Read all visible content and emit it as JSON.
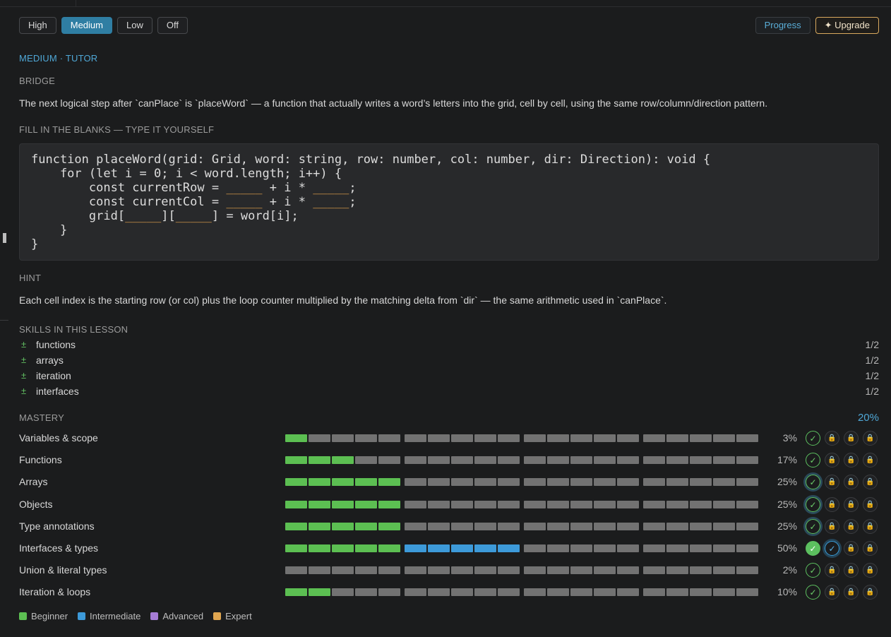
{
  "levels": [
    "High",
    "Medium",
    "Low",
    "Off"
  ],
  "active_level": "Medium",
  "header_buttons": {
    "progress": "Progress",
    "upgrade": "✦ Upgrade"
  },
  "mode_label": "MEDIUM · TUTOR",
  "bridge": {
    "heading": "BRIDGE",
    "text": "The next logical step after `canPlace` is `placeWord` — a function that actually writes a word’s letters into the grid, cell by cell, using the same row/column/direction pattern."
  },
  "fill": {
    "heading": "FILL IN THE BLANKS — TYPE IT YOURSELF",
    "code_lines": [
      [
        "function placeWord(grid: Grid, word: string, row: number, col: number, dir: Direction): void {"
      ],
      [
        "    for (let i = 0; i < word.length; i++) {"
      ],
      [
        "        const currentRow = ",
        "_____",
        " + i * ",
        "_____",
        ";"
      ],
      [
        "        const currentCol = ",
        "_____",
        " + i * ",
        "_____",
        ";"
      ],
      [
        "        grid[",
        "_____",
        "][",
        "_____",
        "] = word[i];"
      ],
      [
        "    }"
      ],
      [
        "}"
      ]
    ]
  },
  "hint": {
    "heading": "HINT",
    "text": "Each cell index is the starting row (or col) plus the loop counter multiplied by the matching delta from `dir` — the same arithmetic used in `canPlace`."
  },
  "skills": {
    "heading": "SKILLS IN THIS LESSON",
    "items": [
      {
        "mark": "±",
        "name": "functions",
        "score": "1/2"
      },
      {
        "mark": "±",
        "name": "arrays",
        "score": "1/2"
      },
      {
        "mark": "±",
        "name": "iteration",
        "score": "1/2"
      },
      {
        "mark": "±",
        "name": "interfaces",
        "score": "1/2"
      }
    ]
  },
  "mastery": {
    "heading": "MASTERY",
    "overall": "20%",
    "colors": {
      "beginner": "#5cbf52",
      "intermediate": "#3d9ad9",
      "advanced": "#a67cd6",
      "expert": "#e0a650",
      "empty": "#727272"
    },
    "topics": [
      {
        "name": "Variables & scope",
        "percent": "3%",
        "beginner": 1,
        "intermediate": 0,
        "badges": [
          "ok",
          "lock",
          "lock",
          "lock"
        ]
      },
      {
        "name": "Functions",
        "percent": "17%",
        "beginner": 3,
        "intermediate": 0,
        "badges": [
          "ok",
          "lock",
          "lock",
          "lock"
        ]
      },
      {
        "name": "Arrays",
        "percent": "25%",
        "beginner": 5,
        "intermediate": 0,
        "badges": [
          "ok-ring",
          "lock",
          "lock",
          "lock"
        ]
      },
      {
        "name": "Objects",
        "percent": "25%",
        "beginner": 5,
        "intermediate": 0,
        "badges": [
          "ok-ring",
          "lock",
          "lock",
          "lock"
        ]
      },
      {
        "name": "Type annotations",
        "percent": "25%",
        "beginner": 5,
        "intermediate": 0,
        "badges": [
          "ok-ring",
          "lock",
          "lock",
          "lock"
        ]
      },
      {
        "name": "Interfaces & types",
        "percent": "50%",
        "beginner": 5,
        "intermediate": 5,
        "badges": [
          "fill",
          "blue",
          "lock",
          "lock"
        ]
      },
      {
        "name": "Union & literal types",
        "percent": "2%",
        "beginner": 0,
        "intermediate": 0,
        "badges": [
          "ok",
          "lock",
          "lock",
          "lock"
        ]
      },
      {
        "name": "Iteration & loops",
        "percent": "10%",
        "beginner": 2,
        "intermediate": 0,
        "badges": [
          "ok",
          "lock",
          "lock",
          "lock"
        ]
      }
    ],
    "legend": [
      "Beginner",
      "Intermediate",
      "Advanced",
      "Expert"
    ]
  }
}
